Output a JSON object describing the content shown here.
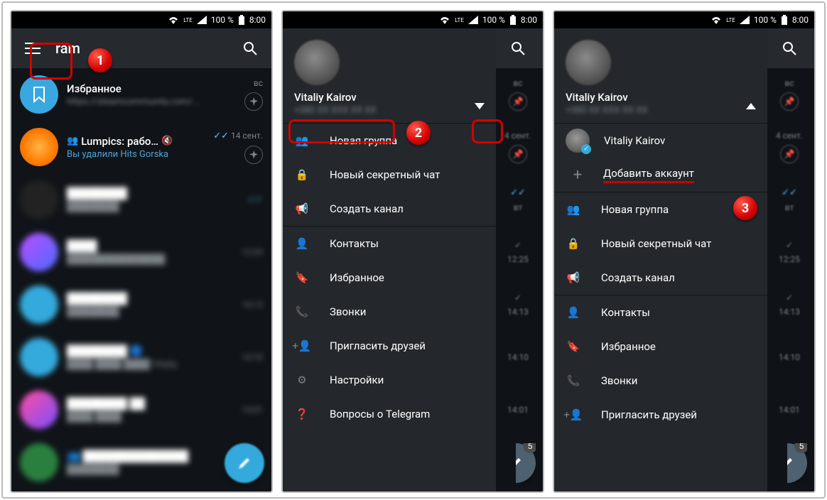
{
  "statusbar": {
    "lte": "LTE",
    "battery_pct": "100 %",
    "time": "8:00"
  },
  "app": {
    "title_suffix": "ram"
  },
  "chats": {
    "favorites": {
      "name": "Избранное",
      "url_fragment": "https://steamcommunity.com/...",
      "day": "вс"
    },
    "lumpics": {
      "name": "Lumpics: рабо…",
      "msg": "Вы удалили Hits Gorska",
      "day": "14 сент."
    }
  },
  "drawer": {
    "user_name": "Vitaliy Kairov",
    "phone_hidden": "+380 XX XXX XX XX",
    "items": {
      "new_group": "Новая группа",
      "secret_chat": "Новый секретный чат",
      "create_channel": "Создать канал",
      "contacts": "Контакты",
      "favorites": "Избранное",
      "calls": "Звонки",
      "invite": "Пригласить друзей",
      "settings": "Настройки",
      "faq": "Вопросы о Telegram"
    }
  },
  "accounts": {
    "current": "Vitaliy Kairov",
    "add": "Добавить аккаунт"
  },
  "bg_times": {
    "t1": "вт",
    "t2": "12:25",
    "t3": "14:13",
    "t4": "14:10",
    "t5": "14:01"
  },
  "fab_badge": "5",
  "callouts": {
    "n1": "1",
    "n2": "2",
    "n3": "3"
  }
}
